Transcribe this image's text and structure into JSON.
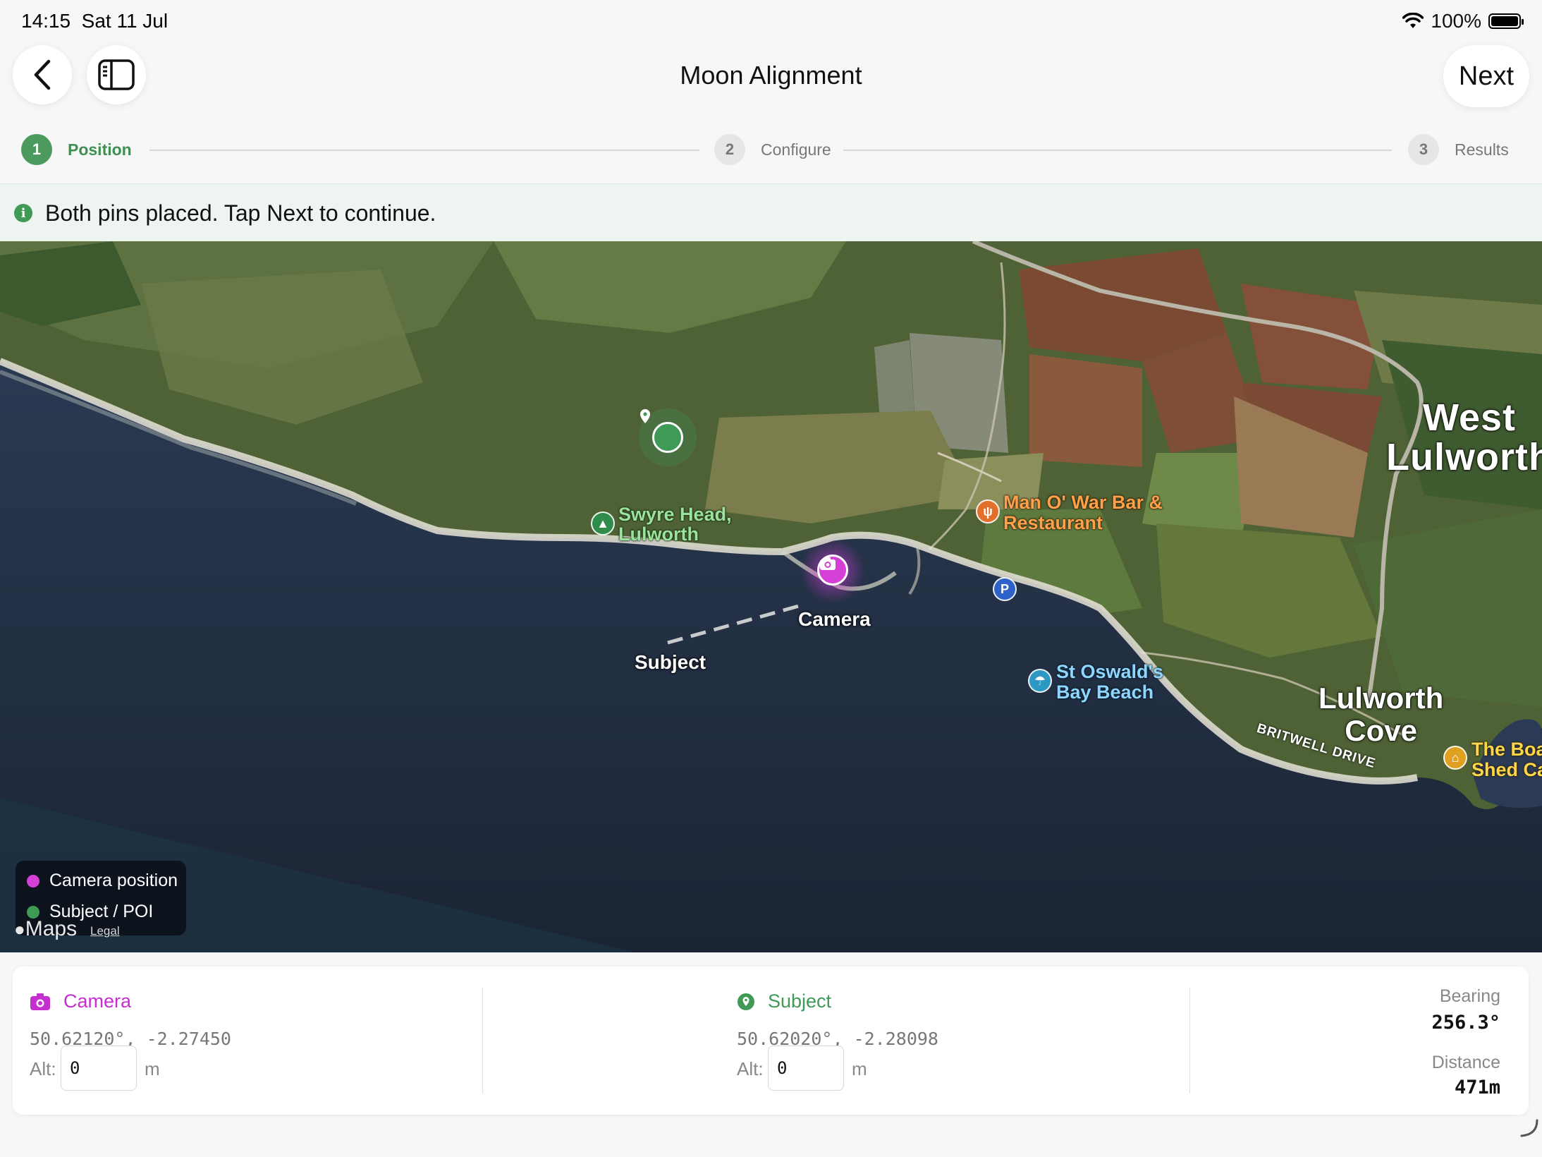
{
  "status": {
    "time": "14:15",
    "date": "Sat 11 Jul",
    "battery": "100%"
  },
  "nav": {
    "title": "Moon Alignment",
    "next_label": "Next",
    "back_icon": "chevron-left-icon",
    "sidebar_icon": "sidebar-icon"
  },
  "stepper": [
    {
      "num": "1",
      "label": "Position",
      "active": true
    },
    {
      "num": "2",
      "label": "Configure",
      "active": false
    },
    {
      "num": "3",
      "label": "Results",
      "active": false
    }
  ],
  "banner": {
    "icon": "info-icon",
    "text": "Both pins placed. Tap Next to continue."
  },
  "map": {
    "labels": {
      "swyre": "Swyre Head,\nLulworth",
      "manowar": "Man O' War Bar &\nRestaurant",
      "st_oswald": "St Oswald's\nBay Beach",
      "west_lulworth": "West\nLulworth",
      "lulworth_cove": "Lulworth\nCove",
      "britwell": "BRITWELL DRIVE",
      "boat_shed": "The Boa\nShed Ca",
      "parking": "P"
    },
    "pins": {
      "camera": "Camera",
      "subject": "Subject"
    },
    "legend": {
      "camera": "Camera position",
      "subject": "Subject / POI"
    },
    "attribution": {
      "logo": "Maps",
      "legal": "Legal"
    }
  },
  "panel": {
    "camera": {
      "title": "Camera",
      "coords": "50.62120°, -2.27450",
      "alt_label": "Alt:",
      "alt_value": "0",
      "unit": "m",
      "color": "#c62fd0"
    },
    "subject": {
      "title": "Subject",
      "coords": "50.62020°, -2.28098",
      "alt_label": "Alt:",
      "alt_value": "0",
      "unit": "m",
      "color": "#3f9a55"
    },
    "bearing": {
      "label": "Bearing",
      "value": "256.3°"
    },
    "distance": {
      "label": "Distance",
      "value": "471m"
    }
  }
}
